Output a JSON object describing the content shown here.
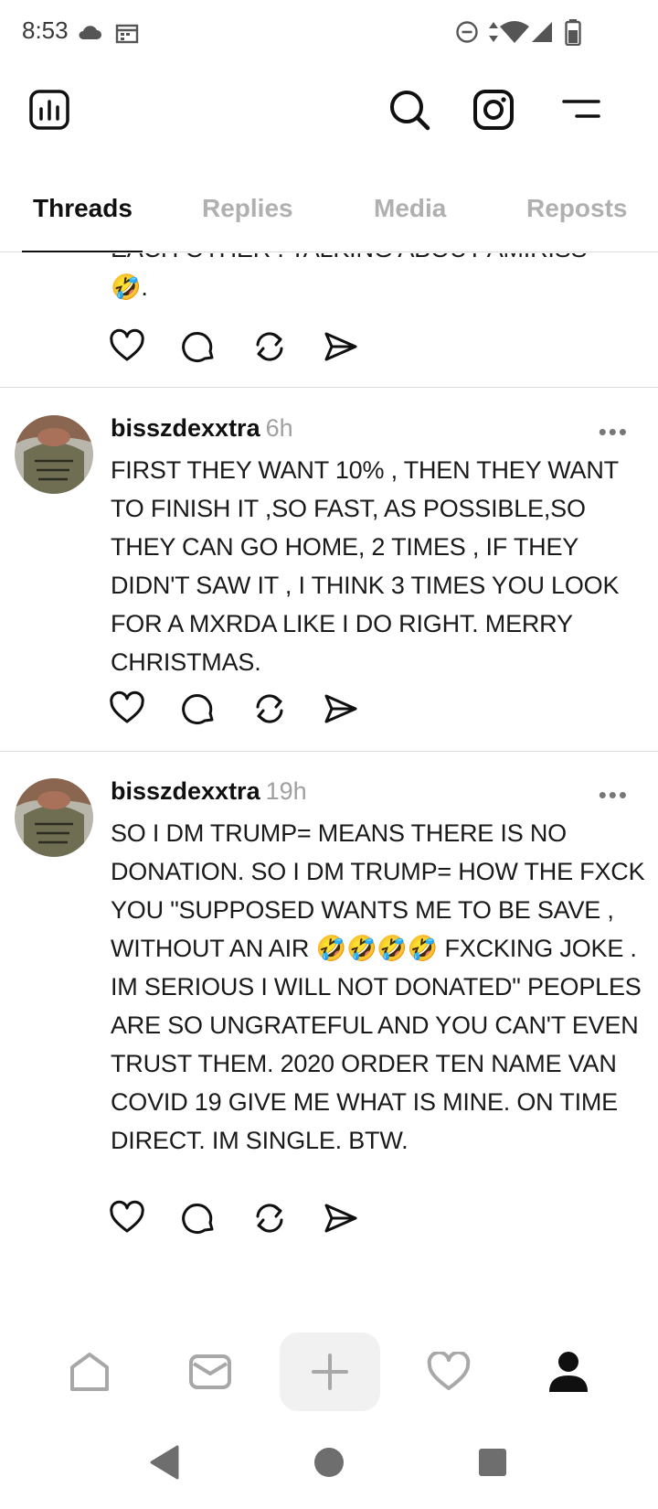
{
  "status_bar": {
    "time": "8:53",
    "icons": [
      "cloud-icon",
      "calendar-icon",
      "do-not-disturb-icon",
      "data-arrows-icon",
      "wifi-icon",
      "signal-icon",
      "battery-icon"
    ]
  },
  "header": {
    "icons": [
      "insights-icon",
      "search-icon",
      "instagram-icon",
      "menu-icon"
    ]
  },
  "tabs": [
    {
      "label": "Threads",
      "active": true
    },
    {
      "label": "Replies",
      "active": false
    },
    {
      "label": "Media",
      "active": false
    },
    {
      "label": "Reposts",
      "active": false
    }
  ],
  "partial_post": {
    "text_line1": "EACH OTHER . TALKING ABOUT AMIRISS",
    "text_line2": "🤣."
  },
  "posts": [
    {
      "username": "bisszdexxtra",
      "time": "6h",
      "more": "•••",
      "text": "FIRST THEY WANT 10% , THEN THEY WANT TO FINISH IT ,SO FAST, AS POSSIBLE,SO THEY CAN  GO HOME, 2 TIMES , IF THEY DIDN'T SAW IT , I THINK 3 TIMES YOU LOOK FOR A MXRDA LIKE I DO RIGHT. MERRY CHRISTMAS."
    },
    {
      "username": "bisszdexxtra",
      "time": "19h",
      "more": "•••",
      "text": "SO I DM TRUMP= MEANS THERE IS NO DONATION. SO I DM TRUMP= HOW THE FXCK YOU \"SUPPOSED WANTS ME TO BE SAVE , WITHOUT AN AIR 🤣🤣🤣🤣 FXCKING JOKE . IM SERIOUS I WILL NOT DONATED\" PEOPLES ARE SO UNGRATEFUL AND YOU CAN'T EVEN TRUST THEM. 2020 ORDER TEN NAME VAN COVID 19 GIVE ME WHAT IS MINE. ON TIME DIRECT. IM SINGLE. BTW."
    }
  ],
  "post_actions": [
    "heart-icon",
    "comment-icon",
    "repost-icon",
    "share-icon"
  ],
  "bottom_nav": [
    "home-icon",
    "mail-icon",
    "compose-icon",
    "activity-heart-icon",
    "profile-icon"
  ],
  "system_nav": [
    "back-icon",
    "home-circle-icon",
    "recents-icon"
  ],
  "colors": {
    "text": "#101010",
    "muted": "#a0a0a0",
    "divider": "#dcdcdc",
    "compose_bg": "#f1f1f1"
  }
}
